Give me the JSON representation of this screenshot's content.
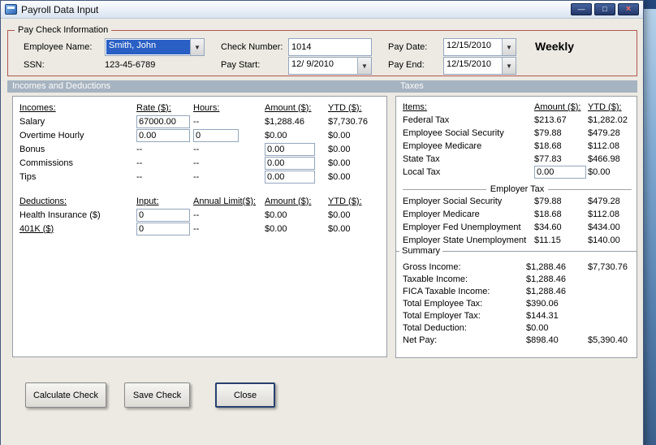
{
  "window": {
    "title": "Payroll Data Input"
  },
  "icons": {
    "dropdown_arrow": "▼",
    "minimize_glyph": "—",
    "maximize_glyph": "□",
    "close_glyph": "×"
  },
  "colors": {
    "selection_blue": "#2a5fc4",
    "group_border_red": "#b0574e",
    "section_band": "#a6b3c0"
  },
  "paycheck": {
    "legend": "Pay Check Information",
    "employee_name_label": "Employee Name:",
    "employee_name_value": "Smith, John",
    "ssn_label": "SSN:",
    "ssn_value": "123-45-6789",
    "check_number_label": "Check Number:",
    "check_number_value": "1014",
    "pay_start_label": "Pay Start:",
    "pay_start_value": "12/ 9/2010",
    "pay_date_label": "Pay Date:",
    "pay_date_value": "12/15/2010",
    "pay_end_label": "Pay End:",
    "pay_end_value": "12/15/2010",
    "frequency": "Weekly"
  },
  "sections": {
    "left": "Incomes and Deductions",
    "right": "Taxes"
  },
  "incomes": {
    "headers": {
      "name": "Incomes:",
      "rate": "Rate ($):",
      "hours": "Hours:",
      "amount": "Amount ($):",
      "ytd": "YTD ($):"
    },
    "salary": {
      "label": "Salary",
      "rate": "67000.00",
      "hours": "--",
      "amount": "$1,288.46",
      "ytd": "$7,730.76"
    },
    "overtime": {
      "label": "Overtime Hourly",
      "rate": "0.00",
      "hours": "0",
      "amount": "$0.00",
      "ytd": "$0.00"
    },
    "bonus": {
      "label": "Bonus",
      "rate": "--",
      "hours": "--",
      "amount": "0.00",
      "ytd": "$0.00"
    },
    "commissions": {
      "label": "Commissions",
      "rate": "--",
      "hours": "--",
      "amount": "0.00",
      "ytd": "$0.00"
    },
    "tips": {
      "label": "Tips",
      "rate": "--",
      "hours": "--",
      "amount": "0.00",
      "ytd": "$0.00"
    }
  },
  "deductions": {
    "headers": {
      "name": "Deductions:",
      "input": "Input:",
      "limit": "Annual Limit($):",
      "amount": "Amount ($):",
      "ytd": "YTD ($):"
    },
    "health": {
      "label": "Health Insurance ($)",
      "input": "0",
      "limit": "--",
      "amount": "$0.00",
      "ytd": "$0.00"
    },
    "k401": {
      "label": "401K ($)",
      "input": "0",
      "limit": "--",
      "amount": "$0.00",
      "ytd": "$0.00"
    }
  },
  "taxes": {
    "headers": {
      "item": "Items:",
      "amount": "Amount ($):",
      "ytd": "YTD ($):"
    },
    "rows": [
      {
        "label": "Federal Tax",
        "amount": "$213.67",
        "ytd": "$1,282.02"
      },
      {
        "label": "Employee Social Security",
        "amount": "$79.88",
        "ytd": "$479.28"
      },
      {
        "label": "Employee Medicare",
        "amount": "$18.68",
        "ytd": "$112.08"
      },
      {
        "label": "State Tax",
        "amount": "$77.83",
        "ytd": "$466.98"
      }
    ],
    "local": {
      "label": "Local Tax",
      "input": "0.00",
      "ytd": "$0.00"
    },
    "employer_header": "Employer Tax",
    "employer_rows": [
      {
        "label": "Employer Social Security",
        "amount": "$79.88",
        "ytd": "$479.28"
      },
      {
        "label": "Employer Medicare",
        "amount": "$18.68",
        "ytd": "$112.08"
      },
      {
        "label": "Employer Fed Unemployment",
        "amount": "$34.60",
        "ytd": "$434.00"
      },
      {
        "label": "Employer State Unemployment",
        "amount": "$11.15",
        "ytd": "$140.00"
      }
    ]
  },
  "summary": {
    "legend": "Summary",
    "rows": [
      {
        "label": "Gross Income:",
        "amount": "$1,288.46",
        "ytd": "$7,730.76"
      },
      {
        "label": "Taxable Income:",
        "amount": "$1,288.46",
        "ytd": ""
      },
      {
        "label": "FICA Taxable Income:",
        "amount": "$1,288.46",
        "ytd": ""
      },
      {
        "label": "Total Employee Tax:",
        "amount": "$390.06",
        "ytd": ""
      },
      {
        "label": "Total Employer Tax:",
        "amount": "$144.31",
        "ytd": ""
      },
      {
        "label": "Total Deduction:",
        "amount": "$0.00",
        "ytd": ""
      },
      {
        "label": "Net Pay:",
        "amount": "$898.40",
        "ytd": "$5,390.40"
      }
    ]
  },
  "buttons": {
    "calculate": "Calculate Check",
    "save": "Save Check",
    "close": "Close"
  }
}
